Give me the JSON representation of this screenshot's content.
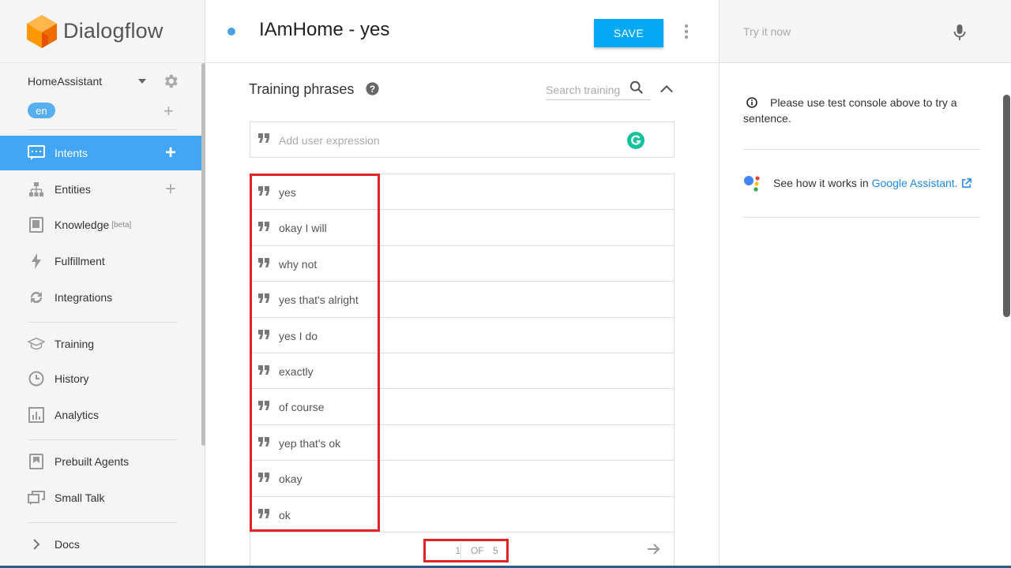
{
  "app": {
    "name": "Dialogflow"
  },
  "agent": {
    "name": "HomeAssistant",
    "language": "en"
  },
  "nav": [
    {
      "id": "intents",
      "label": "Intents"
    },
    {
      "id": "entities",
      "label": "Entities"
    },
    {
      "id": "knowledge",
      "label": "Knowledge",
      "badge": "[beta]"
    },
    {
      "id": "fulfillment",
      "label": "Fulfillment"
    },
    {
      "id": "integrations",
      "label": "Integrations"
    },
    {
      "id": "training",
      "label": "Training"
    },
    {
      "id": "history",
      "label": "History"
    },
    {
      "id": "analytics",
      "label": "Analytics"
    },
    {
      "id": "prebuilt",
      "label": "Prebuilt Agents"
    },
    {
      "id": "smalltalk",
      "label": "Small Talk"
    },
    {
      "id": "docs",
      "label": "Docs"
    }
  ],
  "header": {
    "intent_title": "IAmHome - yes",
    "save_label": "SAVE"
  },
  "training": {
    "title": "Training phrases",
    "search_placeholder": "Search training phrases",
    "add_placeholder": "Add user expression",
    "phrases": [
      "yes",
      "okay I will",
      "why not",
      "yes that's alright",
      "yes I do",
      "exactly",
      "of course",
      "yep that's ok",
      "okay",
      "ok"
    ],
    "pagination": {
      "current": "1",
      "of_label": "OF",
      "total": "5"
    }
  },
  "test_console": {
    "placeholder": "Try it now",
    "info_text": "Please use test console above to try a sentence.",
    "ga_text": "See how it works in",
    "ga_link": "Google Assistant."
  },
  "colors": {
    "accent": "#42a5f5",
    "save": "#03a9f4",
    "highlight": "#e02424",
    "logo": "#ff9800"
  }
}
